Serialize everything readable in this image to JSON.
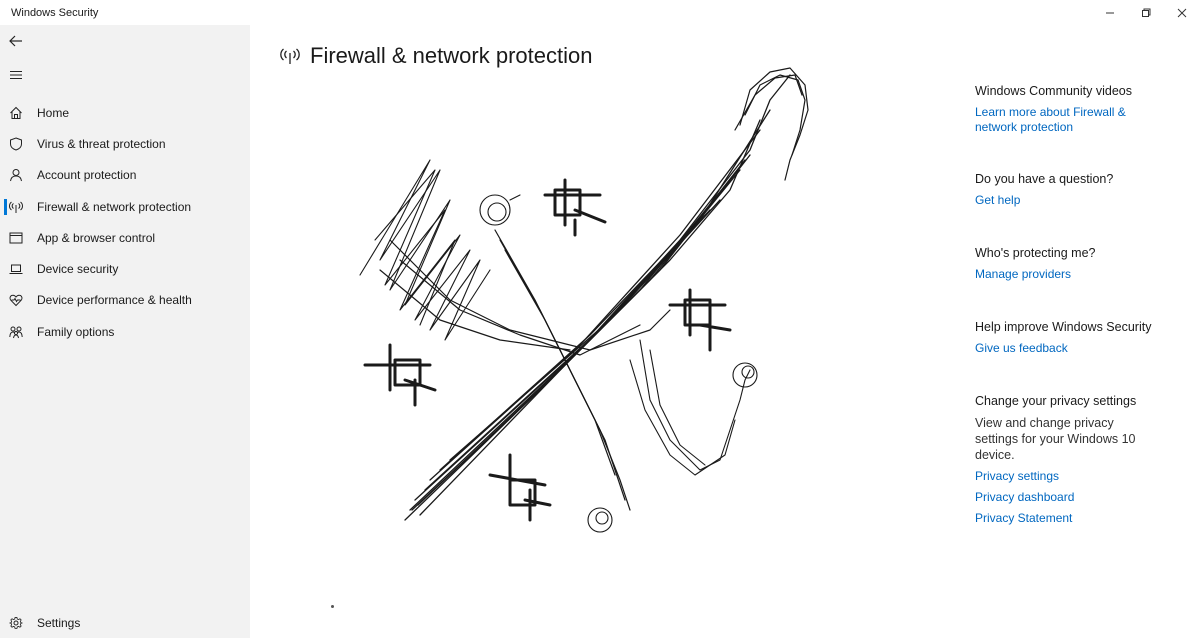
{
  "window": {
    "title": "Windows Security",
    "controls": {
      "minimize_icon": "minimize-icon",
      "restore_icon": "restore-icon",
      "close_icon": "close-icon"
    }
  },
  "sidebar": {
    "back_icon": "back-arrow-icon",
    "menu_icon": "hamburger-menu-icon",
    "items": [
      {
        "label": "Home",
        "icon": "home-icon",
        "selected": false
      },
      {
        "label": "Virus & threat protection",
        "icon": "shield-icon",
        "selected": false
      },
      {
        "label": "Account protection",
        "icon": "person-icon",
        "selected": false
      },
      {
        "label": "Firewall & network protection",
        "icon": "antenna-icon",
        "selected": true
      },
      {
        "label": "App & browser control",
        "icon": "browser-window-icon",
        "selected": false
      },
      {
        "label": "Device security",
        "icon": "laptop-icon",
        "selected": false
      },
      {
        "label": "Device performance & health",
        "icon": "heart-pulse-icon",
        "selected": false
      },
      {
        "label": "Family options",
        "icon": "family-icon",
        "selected": false
      }
    ],
    "settings": {
      "label": "Settings",
      "icon": "gear-icon"
    }
  },
  "main": {
    "title": "Firewall & network protection",
    "title_icon": "antenna-icon",
    "drawing_description": "hand-drawn black scribble sketch"
  },
  "aside": {
    "sections": [
      {
        "heading": "Windows Community videos",
        "links": [
          "Learn more about Firewall & network protection"
        ]
      },
      {
        "heading": "Do you have a question?",
        "links": [
          "Get help"
        ]
      },
      {
        "heading": "Who's protecting me?",
        "links": [
          "Manage providers"
        ]
      },
      {
        "heading": "Help improve Windows Security",
        "links": [
          "Give us feedback"
        ]
      },
      {
        "heading": "Change your privacy settings",
        "text": "View and change privacy settings for your Windows 10 device.",
        "links": [
          "Privacy settings",
          "Privacy dashboard",
          "Privacy Statement"
        ]
      }
    ]
  },
  "colors": {
    "accent": "#0078d7",
    "link": "#0067c0",
    "sidebar_bg": "#f2f2f2",
    "main_bg": "#ffffff"
  }
}
